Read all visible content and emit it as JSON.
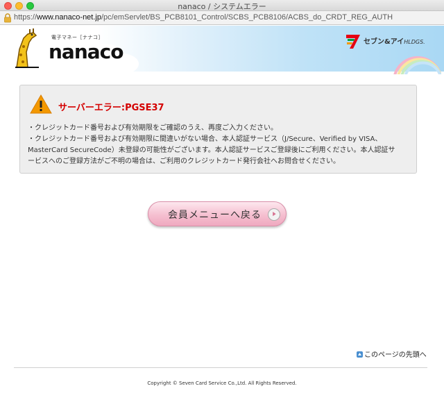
{
  "window": {
    "title": "nanaco / システムエラー"
  },
  "browser": {
    "url_prefix": "https://",
    "url_domain": "www.nanaco-net.jp",
    "url_path": "/pc/emServlet/BS_PCB8101_Control/SCBS_PCB8106/ACBS_do_CRDT_REG_AUTH"
  },
  "header": {
    "logo_tagline": "電子マネー［ナナコ］",
    "logo_text": "nanaco",
    "corp_logo_text": "セブン&アイ",
    "corp_logo_suffix": "HLDGS."
  },
  "error": {
    "title": "サーバーエラー:PGSE37",
    "lines": [
      "・クレジットカード番号および有効期限をご確認のうえ、再度ご入力ください。",
      "・クレジットカード番号および有効期限に間違いがない場合、本人認証サービス（J/Secure、Verified by VISA、",
      "MasterCard SecureCode）未登録の可能性がございます。本人認証サービスご登録後にご利用ください。本人認証サ",
      "ービスへのご登録方法がご不明の場合は、ご利用のクレジットカード発行会社へお問合せください。"
    ]
  },
  "back_button": {
    "label": "会員メニューへ戻る"
  },
  "page_top": {
    "label": "このページの先頭へ"
  },
  "footer": {
    "copyright": "Copyright © Seven Card Service Co.,Ltd. All Rights Reserved."
  },
  "colors": {
    "error_red": "#d40000",
    "button_pink": "#f5bfd0",
    "warning_orange": "#f39800"
  }
}
